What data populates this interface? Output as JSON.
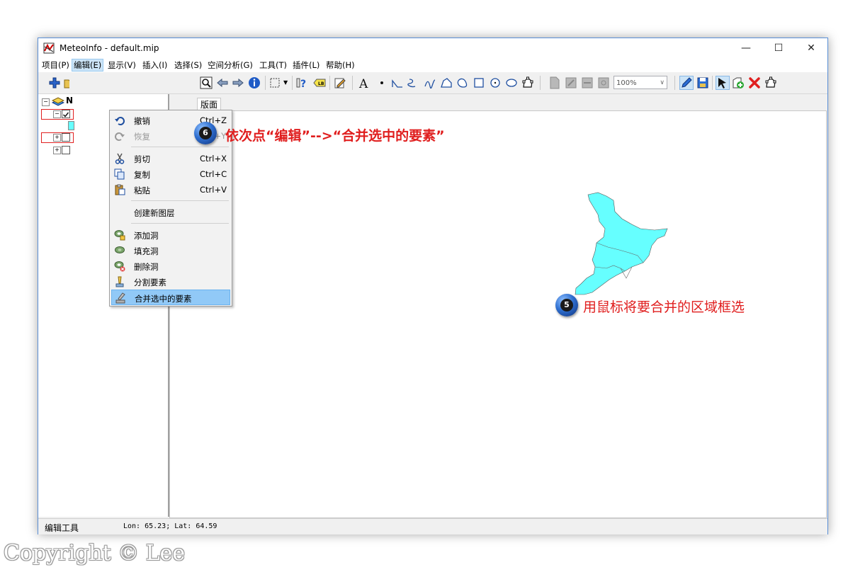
{
  "window": {
    "title": "MeteoInfo - default.mip",
    "minimize": "—",
    "maximize": "☐",
    "close": "✕"
  },
  "menubar": [
    {
      "label": "项目(P)"
    },
    {
      "label": "编辑(E)"
    },
    {
      "label": "显示(V)"
    },
    {
      "label": "插入(I)"
    },
    {
      "label": "选择(S)"
    },
    {
      "label": "空间分析(G)"
    },
    {
      "label": "工具(T)"
    },
    {
      "label": "插件(L)"
    },
    {
      "label": "帮助(H)"
    }
  ],
  "toolbar": {
    "zoom_value": "100%",
    "icons": [
      "add-layer-icon",
      "open-icon",
      "zoom-window-icon",
      "back-icon",
      "forward-icon",
      "identify-icon",
      "select-rect-icon",
      "help-select-icon",
      "label-icon",
      "edit-map-icon",
      "text-icon",
      "point-icon",
      "polyline-icon",
      "curve-icon",
      "freehand-icon",
      "polygon-icon",
      "curve-polygon-icon",
      "rectangle-icon",
      "circle-icon",
      "ellipse-icon",
      "freehand-polygon-icon",
      "page-icon",
      "page-setup-icon",
      "page-fit-icon",
      "page-zoom-icon",
      "edit-pen-icon",
      "save-edit-icon",
      "select-feature-icon",
      "add-feature-icon",
      "delete-feature-icon",
      "edit-vertices-icon"
    ]
  },
  "layer_panel": {
    "root_label": "N"
  },
  "tabs": {
    "layout": "版面"
  },
  "edit_menu": {
    "items": [
      {
        "label": "撤销",
        "shortcut": "Ctrl+Z",
        "icon": "undo-icon",
        "enabled": true
      },
      {
        "label": "恢复",
        "shortcut": "Ctrl+Y",
        "icon": "redo-icon",
        "enabled": false
      },
      {
        "label": "剪切",
        "shortcut": "Ctrl+X",
        "icon": "cut-icon",
        "enabled": true
      },
      {
        "label": "复制",
        "shortcut": "Ctrl+C",
        "icon": "copy-icon",
        "enabled": true
      },
      {
        "label": "粘贴",
        "shortcut": "Ctrl+V",
        "icon": "paste-icon",
        "enabled": true
      },
      {
        "label": "创建新图层",
        "shortcut": "",
        "icon": "",
        "enabled": true
      },
      {
        "label": "添加洞",
        "shortcut": "",
        "icon": "add-hole-icon",
        "enabled": true
      },
      {
        "label": "填充洞",
        "shortcut": "",
        "icon": "fill-hole-icon",
        "enabled": true
      },
      {
        "label": "删除洞",
        "shortcut": "",
        "icon": "delete-hole-icon",
        "enabled": true
      },
      {
        "label": "分割要素",
        "shortcut": "",
        "icon": "split-feature-icon",
        "enabled": true
      },
      {
        "label": "合并选中的要素",
        "shortcut": "",
        "icon": "merge-feature-icon",
        "enabled": true,
        "highlighted": true
      }
    ]
  },
  "annotations": {
    "step6_number": "6",
    "step6_text": "依次点“编辑”-->“合并选中的要素”",
    "step5_number": "5",
    "step5_text": "用鼠标将要合并的区域框选"
  },
  "map": {
    "fill_color": "#66ffff",
    "stroke_color": "#555555"
  },
  "statusbar": {
    "tool": "编辑工具",
    "coords": "Lon: 65.23; Lat: 64.59"
  },
  "watermark": "Copyright © Lee"
}
